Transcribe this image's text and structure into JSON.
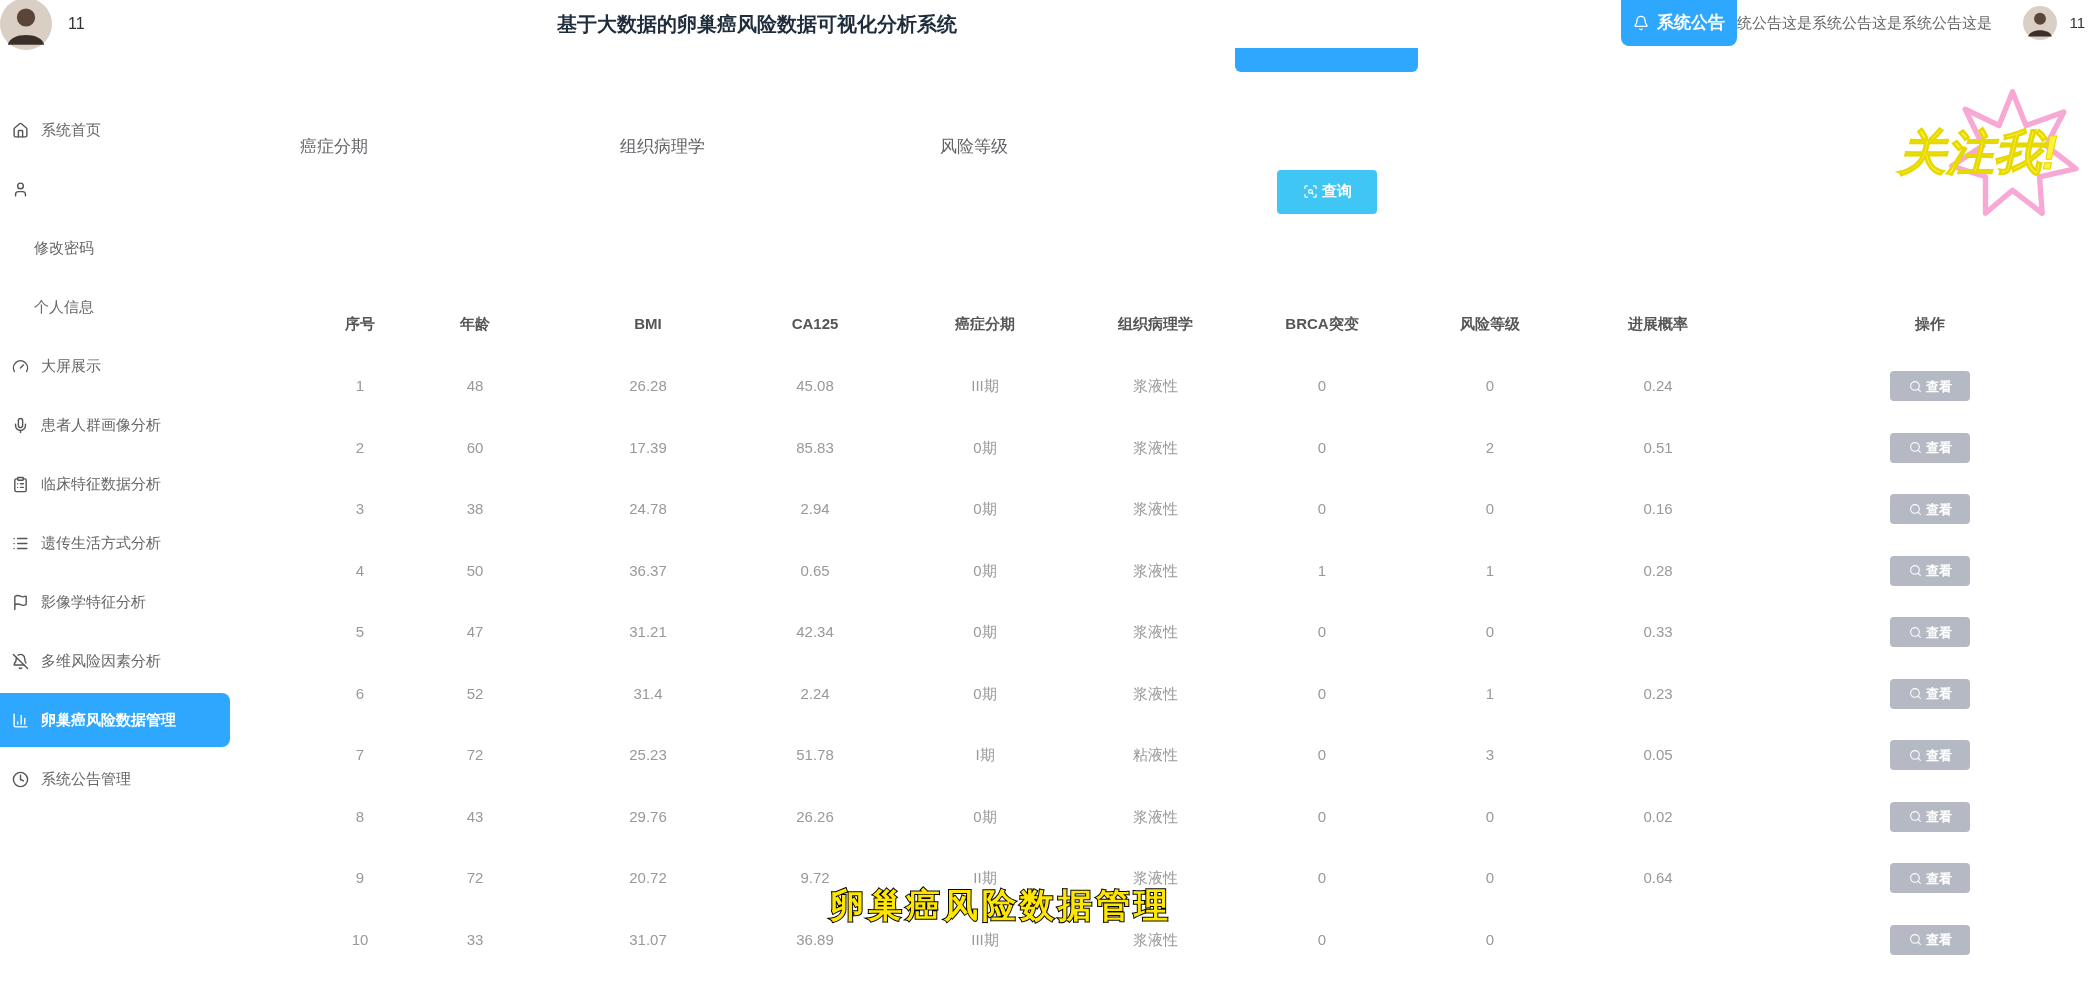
{
  "header": {
    "title": "基于大数据的卵巢癌风险数据可视化分析系统",
    "notice_button": "系统公告",
    "notice_text": "统公告这是系统公告这是系统公告这是",
    "user_name": "11"
  },
  "sidebar": {
    "user_name": "11",
    "items": [
      {
        "label": "系统首页",
        "selected": false
      },
      {
        "selected": false,
        "children": [
          {
            "label": "修改密码",
            "selected": false
          },
          {
            "label": "个人信息",
            "selected": false
          }
        ]
      },
      {
        "label": "大屏展示",
        "selected": false
      },
      {
        "label": "患者人群画像分析",
        "selected": false
      },
      {
        "label": "临床特征数据分析",
        "selected": false
      },
      {
        "label": "遗传生活方式分析",
        "selected": false
      },
      {
        "label": "影像学特征分析",
        "selected": false
      },
      {
        "label": "多维风险因素分析",
        "selected": false
      },
      {
        "label": "卵巢癌风险数据管理",
        "selected": true
      },
      {
        "label": "系统公告管理",
        "selected": false
      }
    ]
  },
  "filters": {
    "labels": [
      "癌症分期",
      "组织病理学",
      "风险等级"
    ],
    "query_button": "查询"
  },
  "table": {
    "columns": [
      "序号",
      "年龄",
      "BMI",
      "CA125",
      "癌症分期",
      "组织病理学",
      "BRCA突变",
      "风险等级",
      "进展概率",
      "操作"
    ],
    "rows": [
      {
        "cells": [
          "1",
          "48",
          "26.28",
          "45.08",
          "III期",
          "浆液性",
          "0",
          "0",
          "0.24"
        ],
        "action": "查看"
      },
      {
        "cells": [
          "2",
          "60",
          "17.39",
          "85.83",
          "0期",
          "浆液性",
          "0",
          "2",
          "0.51"
        ],
        "action": "查看"
      },
      {
        "cells": [
          "3",
          "38",
          "24.78",
          "2.94",
          "0期",
          "浆液性",
          "0",
          "0",
          "0.16"
        ],
        "action": "查看"
      },
      {
        "cells": [
          "4",
          "50",
          "36.37",
          "0.65",
          "0期",
          "浆液性",
          "1",
          "1",
          "0.28"
        ],
        "action": "查看"
      },
      {
        "cells": [
          "5",
          "47",
          "31.21",
          "42.34",
          "0期",
          "浆液性",
          "0",
          "0",
          "0.33"
        ],
        "action": "查看"
      },
      {
        "cells": [
          "6",
          "52",
          "31.4",
          "2.24",
          "0期",
          "浆液性",
          "0",
          "1",
          "0.23"
        ],
        "action": "查看"
      },
      {
        "cells": [
          "7",
          "72",
          "25.23",
          "51.78",
          "I期",
          "粘液性",
          "0",
          "3",
          "0.05"
        ],
        "action": "查看"
      },
      {
        "cells": [
          "8",
          "43",
          "29.76",
          "26.26",
          "0期",
          "浆液性",
          "0",
          "0",
          "0.02"
        ],
        "action": "查看"
      },
      {
        "cells": [
          "9",
          "72",
          "20.72",
          "9.72",
          "II期",
          "浆液性",
          "0",
          "0",
          "0.64"
        ],
        "action": "查看"
      },
      {
        "cells": [
          "10",
          "33",
          "31.07",
          "36.89",
          "III期",
          "浆液性",
          "0",
          "0"
        ],
        "action": "查看"
      }
    ]
  },
  "overlay": {
    "caption": "卵巢癌风险数据管理",
    "sticker": "关注我!"
  }
}
